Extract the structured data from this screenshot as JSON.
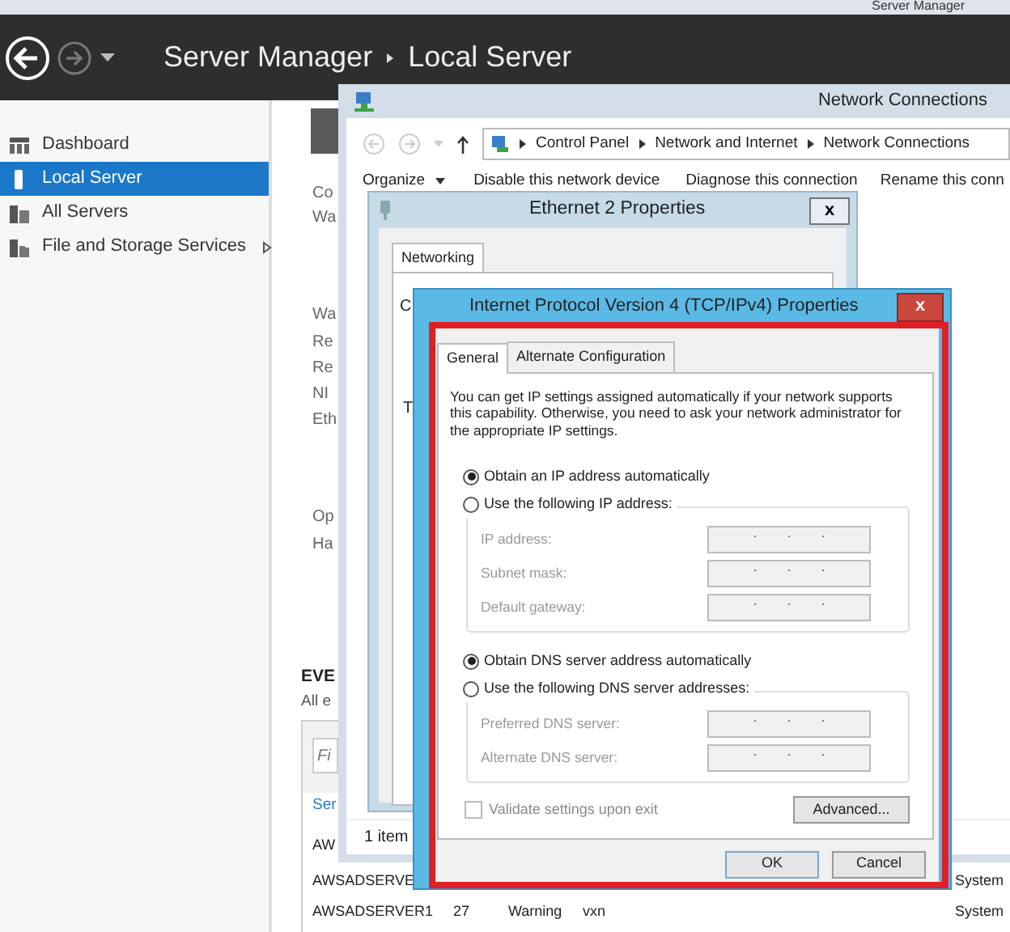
{
  "window": {
    "title": "Server Manager"
  },
  "header": {
    "breadcrumb": [
      "Server Manager",
      "Local Server"
    ]
  },
  "sidebar": {
    "items": [
      {
        "label": "Dashboard",
        "selected": false,
        "has_submenu": false
      },
      {
        "label": "Local Server",
        "selected": true,
        "has_submenu": false
      },
      {
        "label": "All Servers",
        "selected": false,
        "has_submenu": false
      },
      {
        "label": "File and Storage Services",
        "selected": false,
        "has_submenu": true
      }
    ]
  },
  "local_server": {
    "fragments": [
      "Co",
      "Wa",
      "Wa",
      "Re",
      "Re",
      "NI",
      "Eth",
      "Op",
      "Ha"
    ]
  },
  "events": {
    "title": "EVE",
    "subtitle": "All e",
    "filter": {
      "placeholder": "Fi"
    },
    "column_link": "Ser",
    "rows": [
      {
        "cells": [
          "AW"
        ]
      },
      {
        "cells": [
          "AWSADSERVE",
          "",
          "",
          "",
          "System"
        ]
      },
      {
        "cells": [
          "AWSADSERVER1",
          "27",
          "Warning",
          "vxn",
          "System"
        ]
      }
    ]
  },
  "network_connections": {
    "title": "Network Connections",
    "address": [
      "Control Panel",
      "Network and Internet",
      "Network Connections"
    ],
    "toolbar": [
      {
        "label": "Organize",
        "dropdown": true
      },
      {
        "label": "Disable this network device",
        "dropdown": false
      },
      {
        "label": "Diagnose this connection",
        "dropdown": false
      },
      {
        "label": "Rename this conn",
        "dropdown": false
      }
    ],
    "status": "1 item"
  },
  "ethernet_properties": {
    "title": "Ethernet 2 Properties",
    "close": "x",
    "tabs": [
      {
        "label": "Networking",
        "selected": true
      }
    ],
    "fragments": [
      "C",
      "T"
    ]
  },
  "ipv4_properties": {
    "title": "Internet Protocol Version 4 (TCP/IPv4) Properties",
    "close": "x",
    "tabs": [
      {
        "label": "General",
        "selected": true
      },
      {
        "label": "Alternate Configuration",
        "selected": false
      }
    ],
    "description": "You can get IP settings assigned automatically if your network supports this capability. Otherwise, you need to ask your network administrator for the appropriate IP settings.",
    "ip_options": [
      {
        "label": "Obtain an IP address automatically",
        "selected": true
      },
      {
        "label": "Use the following IP address:",
        "selected": false
      }
    ],
    "ip_fields": [
      {
        "label": "IP address:",
        "disabled": true
      },
      {
        "label": "Subnet mask:",
        "disabled": true
      },
      {
        "label": "Default gateway:",
        "disabled": true
      }
    ],
    "dns_options": [
      {
        "label": "Obtain DNS server address automatically",
        "selected": true
      },
      {
        "label": "Use the following DNS server addresses:",
        "selected": false
      }
    ],
    "dns_fields": [
      {
        "label": "Preferred DNS server:",
        "disabled": true
      },
      {
        "label": "Alternate DNS server:",
        "disabled": true
      }
    ],
    "validate": {
      "label": "Validate settings upon exit",
      "checked": false,
      "disabled": true
    },
    "advanced_button": "Advanced...",
    "buttons": [
      "OK",
      "Cancel"
    ]
  }
}
